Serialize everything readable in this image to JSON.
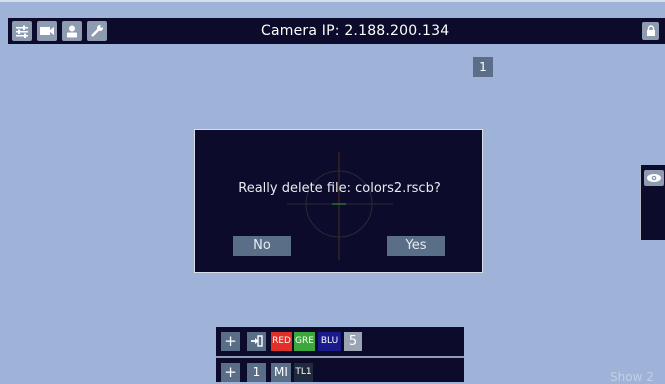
{
  "topbar": {
    "camera_ip": "Camera IP: 2.188.200.134",
    "icons": [
      "sliders-icon",
      "video-camera-icon",
      "user-icon",
      "wrench-icon",
      "lock-icon"
    ]
  },
  "page_badge": "1",
  "side_panel": {
    "icon": "eye-icon"
  },
  "dialog": {
    "message": "Really delete file: colors2.rscb?",
    "no_label": "No",
    "yes_label": "Yes"
  },
  "bottom_panel": {
    "row1": {
      "add_label": "+",
      "import_icon": "sign-in-icon",
      "red_label": "RED",
      "green_label": "GRE",
      "blue_label": "BLU",
      "count_label": "5"
    },
    "row2": {
      "add_label": "+",
      "index_label": "1",
      "mi_label": "MI",
      "tl_label": "TL1"
    }
  },
  "show_label": "Show 2",
  "colors": {
    "background": "#9fb3d9",
    "bar": "#0d0b2c",
    "button": "#5a6f87",
    "red": "#e0302a",
    "green": "#3aa83a",
    "blue": "#1a1a8c"
  }
}
